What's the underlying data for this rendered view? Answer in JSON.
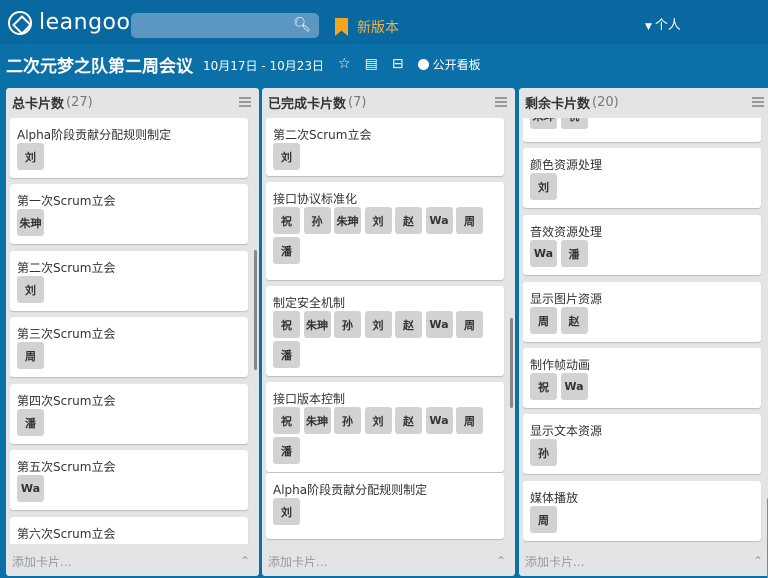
{
  "app": {
    "logo_text": "leangoo",
    "new_version": "新版本",
    "user_menu": "个人"
  },
  "board": {
    "title": "二次元梦之队第二周会议",
    "dates": "10月17日 - 10月23日",
    "public_label": "公开看板"
  },
  "lists": [
    {
      "title": "总卡片数",
      "count": "(27)",
      "add_card": "添加卡片...",
      "cards": [
        {
          "title": "Alpha阶段贡献分配规则制定",
          "tags": [
            "刘"
          ]
        },
        {
          "title": "第一次Scrum立会",
          "tags": [
            "朱珅"
          ]
        },
        {
          "title": "第二次Scrum立会",
          "tags": [
            "刘"
          ]
        },
        {
          "title": "第三次Scrum立会",
          "tags": [
            "周"
          ]
        },
        {
          "title": "第四次Scrum立会",
          "tags": [
            "潘"
          ]
        },
        {
          "title": "第五次Scrum立会",
          "tags": [
            "Wa"
          ]
        },
        {
          "title": "第六次Scrum立会",
          "tags": []
        }
      ]
    },
    {
      "title": "已完成卡片数",
      "count": "(7)",
      "add_card": "添加卡片...",
      "cards": [
        {
          "title": "第二次Scrum立会",
          "tags": [
            "刘"
          ]
        },
        {
          "title": "接口协议标准化",
          "tags": [
            "祝",
            "孙",
            "朱珅",
            "刘",
            "赵",
            "Wa",
            "周",
            "潘"
          ]
        },
        {
          "title": "制定安全机制",
          "tags": [
            "祝",
            "朱珅",
            "孙",
            "刘",
            "赵",
            "Wa",
            "周",
            "潘"
          ]
        },
        {
          "title": "接口版本控制",
          "tags": [
            "祝",
            "朱珅",
            "孙",
            "刘",
            "赵",
            "Wa",
            "周",
            "潘"
          ]
        },
        {
          "title": "Alpha阶段贡献分配规则制定",
          "tags": [
            "刘"
          ]
        }
      ]
    },
    {
      "title": "剩余卡片数",
      "count": "(20)",
      "add_card": "添加卡片...",
      "cards": [
        {
          "title": "",
          "tags": [
            "朱珅",
            "祝"
          ]
        },
        {
          "title": "颜色资源处理",
          "tags": [
            "刘"
          ]
        },
        {
          "title": "音效资源处理",
          "tags": [
            "Wa",
            "潘"
          ]
        },
        {
          "title": "显示图片资源",
          "tags": [
            "周",
            "赵"
          ]
        },
        {
          "title": "制作帧动画",
          "tags": [
            "祝",
            "Wa"
          ]
        },
        {
          "title": "显示文本资源",
          "tags": [
            "孙"
          ]
        },
        {
          "title": "媒体播放",
          "tags": [
            "周"
          ]
        }
      ]
    }
  ]
}
